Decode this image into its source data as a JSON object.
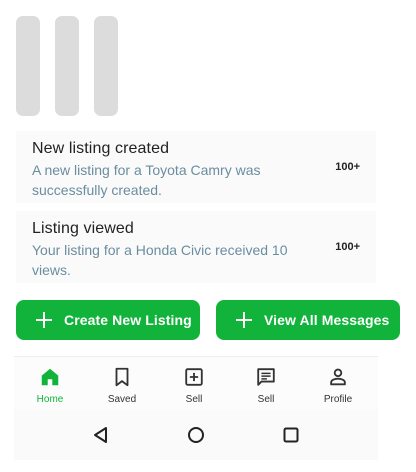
{
  "notifications": [
    {
      "title": "New listing created",
      "body": "A new listing for a Toyota Camry was successfully created.",
      "count": "100+"
    },
    {
      "title": "Listing viewed",
      "body": "Your listing for a Honda Civic received 10 views.",
      "count": "100+"
    }
  ],
  "actions": {
    "create_label": "Create New Listing",
    "messages_label": "View All Messages"
  },
  "bottom_nav": {
    "items": [
      {
        "label": "Home",
        "icon": "home-icon",
        "active": true
      },
      {
        "label": "Saved",
        "icon": "bookmark-icon",
        "active": false
      },
      {
        "label": "Sell",
        "icon": "plus-square-icon",
        "active": false
      },
      {
        "label": "Sell",
        "icon": "message-icon",
        "active": false
      },
      {
        "label": "Profile",
        "icon": "person-icon",
        "active": false
      }
    ]
  },
  "colors": {
    "accent": "#11b33a",
    "secondary_text": "#6a8da0",
    "placeholder": "#dcdcdc"
  }
}
